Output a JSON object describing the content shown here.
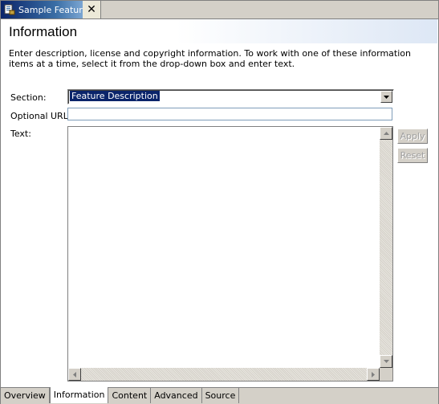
{
  "editor_tab": {
    "title": "Sample Feature",
    "icon": "feature-icon",
    "close_icon": "close-icon"
  },
  "page": {
    "title": "Information",
    "description": "Enter description, license and copyright information. To work with one of these information items at a time, select it from the drop-down box and enter text."
  },
  "form": {
    "section_label": "Section:",
    "section_value": "Feature Description",
    "url_label": "Optional URL:",
    "url_value": "",
    "text_label": "Text:",
    "text_value": ""
  },
  "buttons": {
    "apply": "Apply",
    "reset": "Reset"
  },
  "bottom_tabs": [
    {
      "label": "Overview",
      "active": false
    },
    {
      "label": "Information",
      "active": true
    },
    {
      "label": "Content",
      "active": false
    },
    {
      "label": "Advanced",
      "active": false
    },
    {
      "label": "Source",
      "active": false
    }
  ]
}
